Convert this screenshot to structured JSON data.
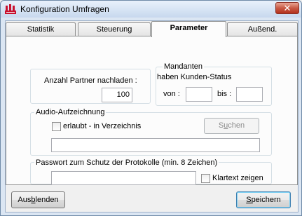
{
  "window": {
    "title": "Konfiguration Umfragen",
    "close_symbol": "✕"
  },
  "tabs": [
    {
      "label": "Statistik"
    },
    {
      "label": "Steuerung"
    },
    {
      "label": "Parameter"
    },
    {
      "label": "Außend."
    }
  ],
  "parameter": {
    "partner": {
      "label": "Anzahl Partner nachladen :",
      "value": "100"
    },
    "mandanten": {
      "title": "Mandanten",
      "subtitle": "haben Kunden-Status",
      "von_label": "von :",
      "von_value": "",
      "bis_label": "bis :",
      "bis_value": ""
    },
    "audio": {
      "title": "Audio-Aufzeichnung",
      "checkbox_label": "erlaubt - in Verzeichnis",
      "search_button_pre": "S",
      "search_button_mnemonic": "u",
      "search_button_post": "chen",
      "directory_value": ""
    },
    "password": {
      "title": "Passwort zum Schutz der Protokolle (min. 8 Zeichen)",
      "value": "",
      "klartext_label": "Klartext zeigen"
    }
  },
  "footer": {
    "hide_button_pre": "Aus",
    "hide_button_mnemonic": "b",
    "hide_button_post": "lenden",
    "save_button_pre": "",
    "save_button_mnemonic": "S",
    "save_button_post": "peichern"
  }
}
